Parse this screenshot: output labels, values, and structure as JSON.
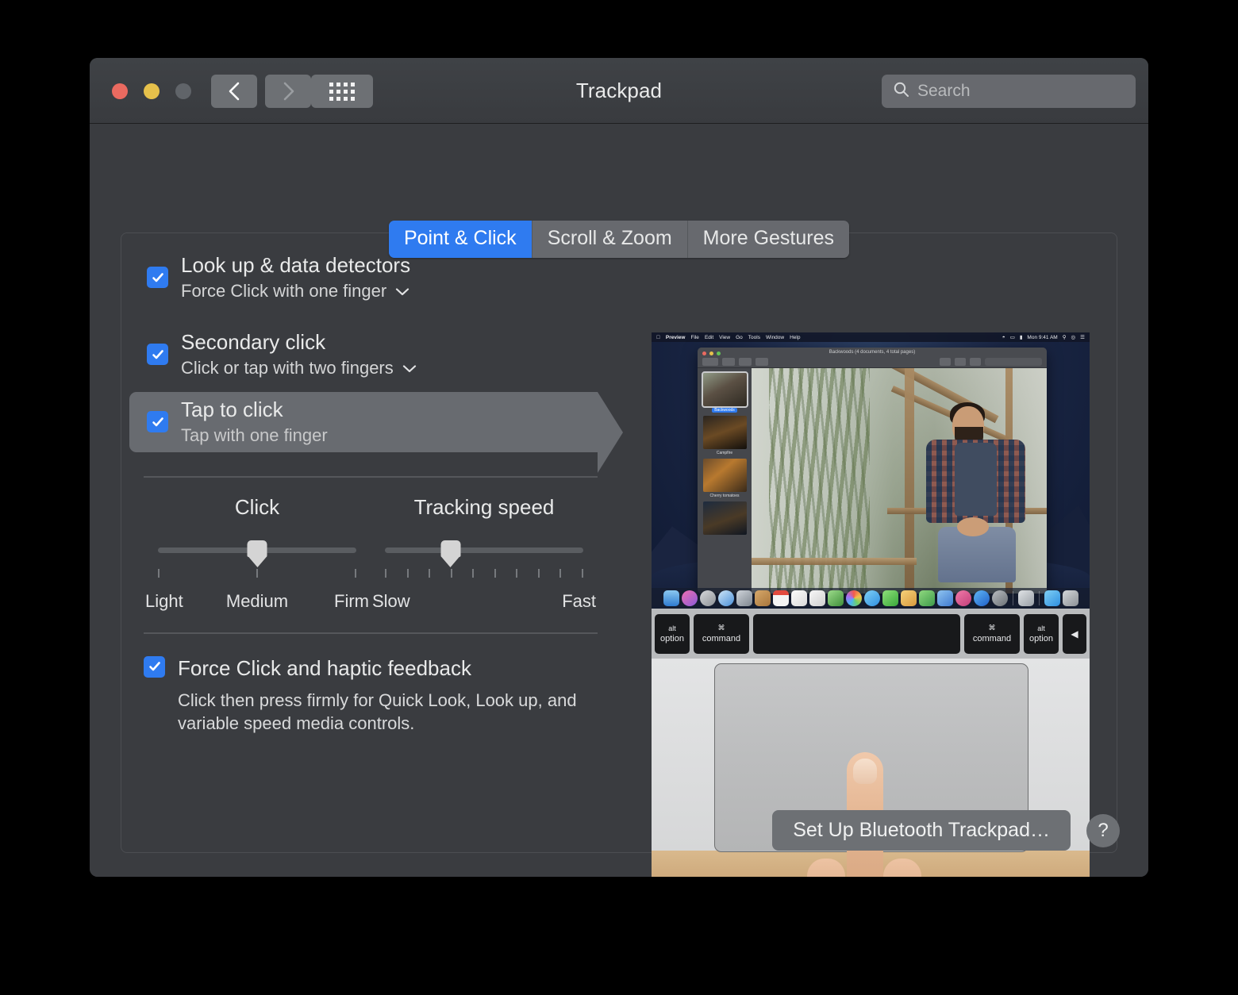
{
  "window": {
    "title": "Trackpad",
    "traffic_lights": [
      "close",
      "minimize",
      "zoom"
    ],
    "nav": {
      "back": "back-chevron",
      "forward": "forward-chevron",
      "show_all": "grid-icon"
    },
    "search": {
      "placeholder": "Search",
      "icon": "search-icon",
      "value": ""
    },
    "accent_color": "#2f7bf0"
  },
  "tabs": [
    {
      "label": "Point & Click",
      "active": true
    },
    {
      "label": "Scroll & Zoom",
      "active": false
    },
    {
      "label": "More Gestures",
      "active": false
    }
  ],
  "options": [
    {
      "title": "Look up & data detectors",
      "sub": "Force Click with one finger",
      "has_dropdown": true,
      "checked": true,
      "selected": false
    },
    {
      "title": "Secondary click",
      "sub": "Click or tap with two fingers",
      "has_dropdown": true,
      "checked": true,
      "selected": false
    },
    {
      "title": "Tap to click",
      "sub": "Tap with one finger",
      "has_dropdown": false,
      "checked": true,
      "selected": true
    }
  ],
  "sliders": [
    {
      "label": "Click",
      "ticks": 3,
      "value_index": 1,
      "value_label": "Medium",
      "scale": [
        "Light",
        "Medium",
        "Firm"
      ]
    },
    {
      "label": "Tracking speed",
      "ticks": 10,
      "value_index": 3,
      "value_label": "",
      "scale": [
        "Slow",
        "Fast"
      ]
    }
  ],
  "force_click": {
    "title": "Force Click and haptic feedback",
    "description": "Click then press firmly for Quick Look, Look up, and variable speed media controls.",
    "checked": true
  },
  "preview": {
    "app_name": "Preview",
    "menubar": [
      "Preview",
      "File",
      "Edit",
      "View",
      "Go",
      "Tools",
      "Window",
      "Help"
    ],
    "menubar_clock": "Mon 9:41 AM",
    "document_title": "Backwoods (4 documents, 4 total pages)",
    "sidebar_items": [
      {
        "label": "Backwoods",
        "selected": true
      },
      {
        "label": "Campfire",
        "selected": false
      },
      {
        "label": "Cherry tomatoes",
        "selected": false
      },
      {
        "label": "",
        "selected": false
      }
    ],
    "search_placeholder": "Search",
    "keyboard_keys": [
      {
        "top": "alt",
        "bottom": "option"
      },
      {
        "top": "⌘",
        "bottom": "command"
      },
      {
        "top": "",
        "bottom": ""
      },
      {
        "top": "⌘",
        "bottom": "command"
      },
      {
        "top": "alt",
        "bottom": "option"
      },
      {
        "top": "◀",
        "bottom": ""
      }
    ]
  },
  "bottom": {
    "setup_button": "Set Up Bluetooth Trackpad…",
    "help_button": "?"
  }
}
